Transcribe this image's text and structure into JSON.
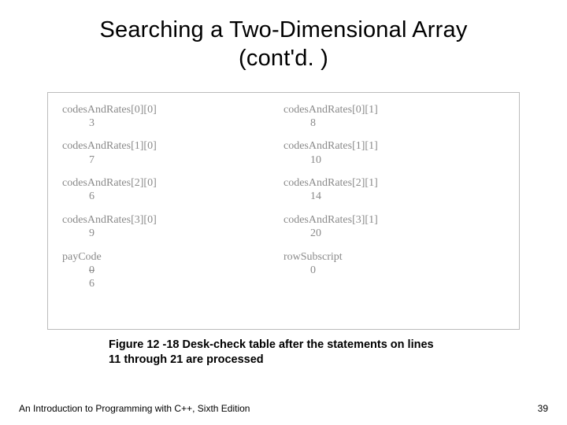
{
  "title_line1": "Searching a Two-Dimensional Array",
  "title_line2": "(cont'd. )",
  "table": {
    "left": [
      {
        "label": "codesAndRates[0][0]",
        "value": "3"
      },
      {
        "label": "codesAndRates[1][0]",
        "value": "7"
      },
      {
        "label": "codesAndRates[2][0]",
        "value": "6"
      },
      {
        "label": "codesAndRates[3][0]",
        "value": "9"
      }
    ],
    "right": [
      {
        "label": "codesAndRates[0][1]",
        "value": "8"
      },
      {
        "label": "codesAndRates[1][1]",
        "value": "10"
      },
      {
        "label": "codesAndRates[2][1]",
        "value": "14"
      },
      {
        "label": "codesAndRates[3][1]",
        "value": "20"
      }
    ],
    "payCode": {
      "label": "payCode",
      "old": "0",
      "new": "6"
    },
    "rowSub": {
      "label": "rowSubscript",
      "value": "0"
    }
  },
  "caption": "Figure 12 -18 Desk-check table after the statements on lines 11 through 21 are processed",
  "footer_left": "An Introduction to Programming with C++, Sixth Edition",
  "footer_right": "39"
}
